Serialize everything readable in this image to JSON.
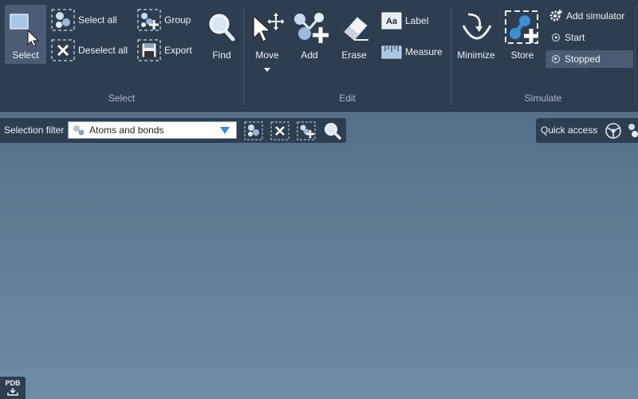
{
  "ribbon": {
    "select_group": {
      "label": "Select",
      "select": "Select",
      "select_all": "Select all",
      "deselect_all": "Deselect all",
      "group": "Group",
      "export": "Export",
      "find": "Find"
    },
    "edit_group": {
      "label": "Edit",
      "move": "Move",
      "add": "Add",
      "erase": "Erase",
      "label_btn": "Label",
      "measure": "Measure"
    },
    "simulate_group": {
      "label": "Simulate",
      "minimize": "Minimize",
      "store": "Store",
      "add_simulator": "Add simulator",
      "start": "Start",
      "stopped": "Stopped"
    }
  },
  "filterbar": {
    "label": "Selection filter",
    "selected": "Atoms and bonds"
  },
  "quick_access": {
    "label": "Quick access"
  },
  "pdb_button": {
    "label": "PDB"
  },
  "colors": {
    "ribbon_bg": "#2e3e51",
    "active_bg": "#4a5d74",
    "accent_blue": "#3b8fd6"
  }
}
